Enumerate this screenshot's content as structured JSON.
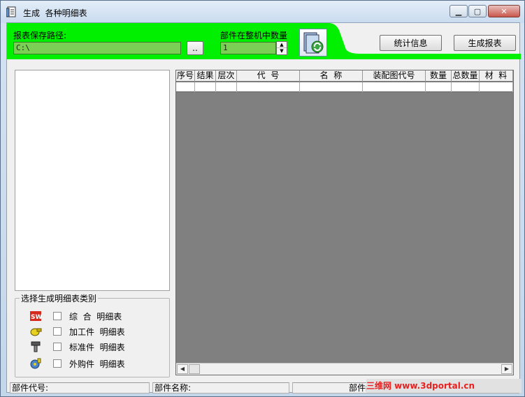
{
  "window": {
    "title": "生成  各种明细表"
  },
  "header": {
    "path_label": "报表保存路径:",
    "path_value": "C:\\",
    "browse_label": "..",
    "qty_label": "部件在整机中数量",
    "qty_value": "1",
    "stats_button": "统计信息",
    "generate_button": "生成报表"
  },
  "left_group": {
    "title": "选择生成明细表类别",
    "options": [
      {
        "icon": "solidworks-icon",
        "label": "综  合  明细表",
        "checked": false
      },
      {
        "icon": "machined-part-icon",
        "label": "加工件  明细表",
        "checked": false
      },
      {
        "icon": "standard-part-icon",
        "label": "标准件  明细表",
        "checked": false
      },
      {
        "icon": "purchased-part-icon",
        "label": "外购件  明细表",
        "checked": false
      }
    ]
  },
  "grid": {
    "columns": [
      "序号",
      "结果",
      "层次",
      "代  号",
      "名  称",
      "装配图代号",
      "数量",
      "总数量",
      "材  料"
    ]
  },
  "statusbar": {
    "part_code": "部件代号:",
    "part_name": "部件名称:",
    "part_stats": "部件统"
  },
  "watermark": "三维网 www.3dportal.cn",
  "colors": {
    "header_green": "#00f000",
    "grid_bg": "#808080"
  }
}
